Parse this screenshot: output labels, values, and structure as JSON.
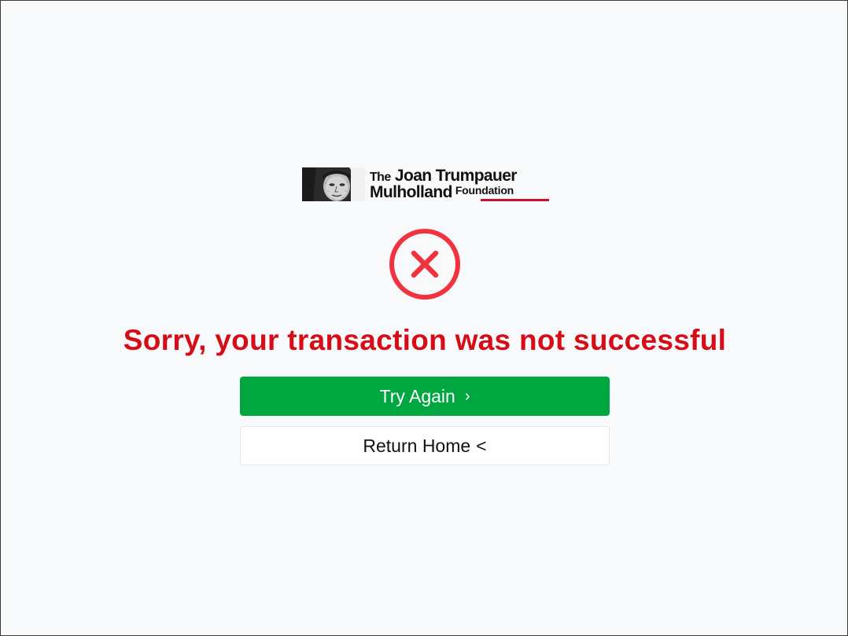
{
  "logo": {
    "line1_prefix": "The",
    "line1_main": "Joan Trumpauer",
    "line2_main": "Mulholland",
    "line2_suffix": "Foundation",
    "accent_color": "#c8102e"
  },
  "status": {
    "icon": "error-circle-x-icon",
    "icon_color": "#f0333f"
  },
  "heading": {
    "text": "Sorry, your transaction was not successful",
    "color": "#d60d16"
  },
  "actions": {
    "try_again_label": "Try Again",
    "try_again_icon": "chevron-right-icon",
    "try_again_glyph": "›",
    "try_again_color": "#00a63f",
    "return_home_label": "Return Home",
    "return_home_icon": "less-than-icon",
    "return_home_glyph": "<"
  }
}
